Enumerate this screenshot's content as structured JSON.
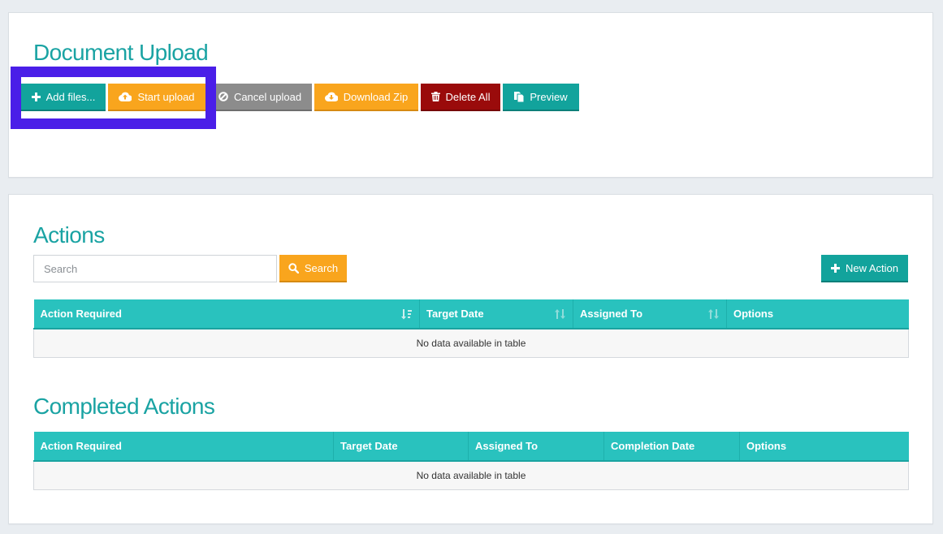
{
  "upload_panel": {
    "title": "Document Upload",
    "buttons": {
      "add_files": "Add files...",
      "start_upload": "Start upload",
      "cancel_upload": "Cancel upload",
      "download_zip": "Download Zip",
      "delete_all": "Delete All",
      "preview": "Preview"
    }
  },
  "actions_panel": {
    "title": "Actions",
    "search": {
      "placeholder": "Search",
      "value": "",
      "button_label": "Search"
    },
    "new_action_label": "New Action",
    "table": {
      "columns": [
        "Action Required",
        "Target Date",
        "Assigned To",
        "Options"
      ],
      "empty_message": "No data available in table"
    }
  },
  "completed_panel": {
    "title": "Completed Actions",
    "table": {
      "columns": [
        "Action Required",
        "Target Date",
        "Assigned To",
        "Completion Date",
        "Options"
      ],
      "empty_message": "No data available in table"
    }
  },
  "icons": {
    "add_files": "plus-icon",
    "start_upload": "cloud-upload-icon",
    "cancel_upload": "ban-icon",
    "download_zip": "cloud-download-icon",
    "delete_all": "trash-icon",
    "preview": "copy-icon",
    "search": "search-icon",
    "new_action": "plus-icon",
    "sort": "sort-icon"
  },
  "colors": {
    "title": "#1aa3a3",
    "teal_button": "#12a39c",
    "orange_button": "#f9a51d",
    "grey_button": "#8c8c8c",
    "red_button": "#9a0b0b",
    "table_header": "#29c2be",
    "highlight": "#4a1ee8"
  }
}
